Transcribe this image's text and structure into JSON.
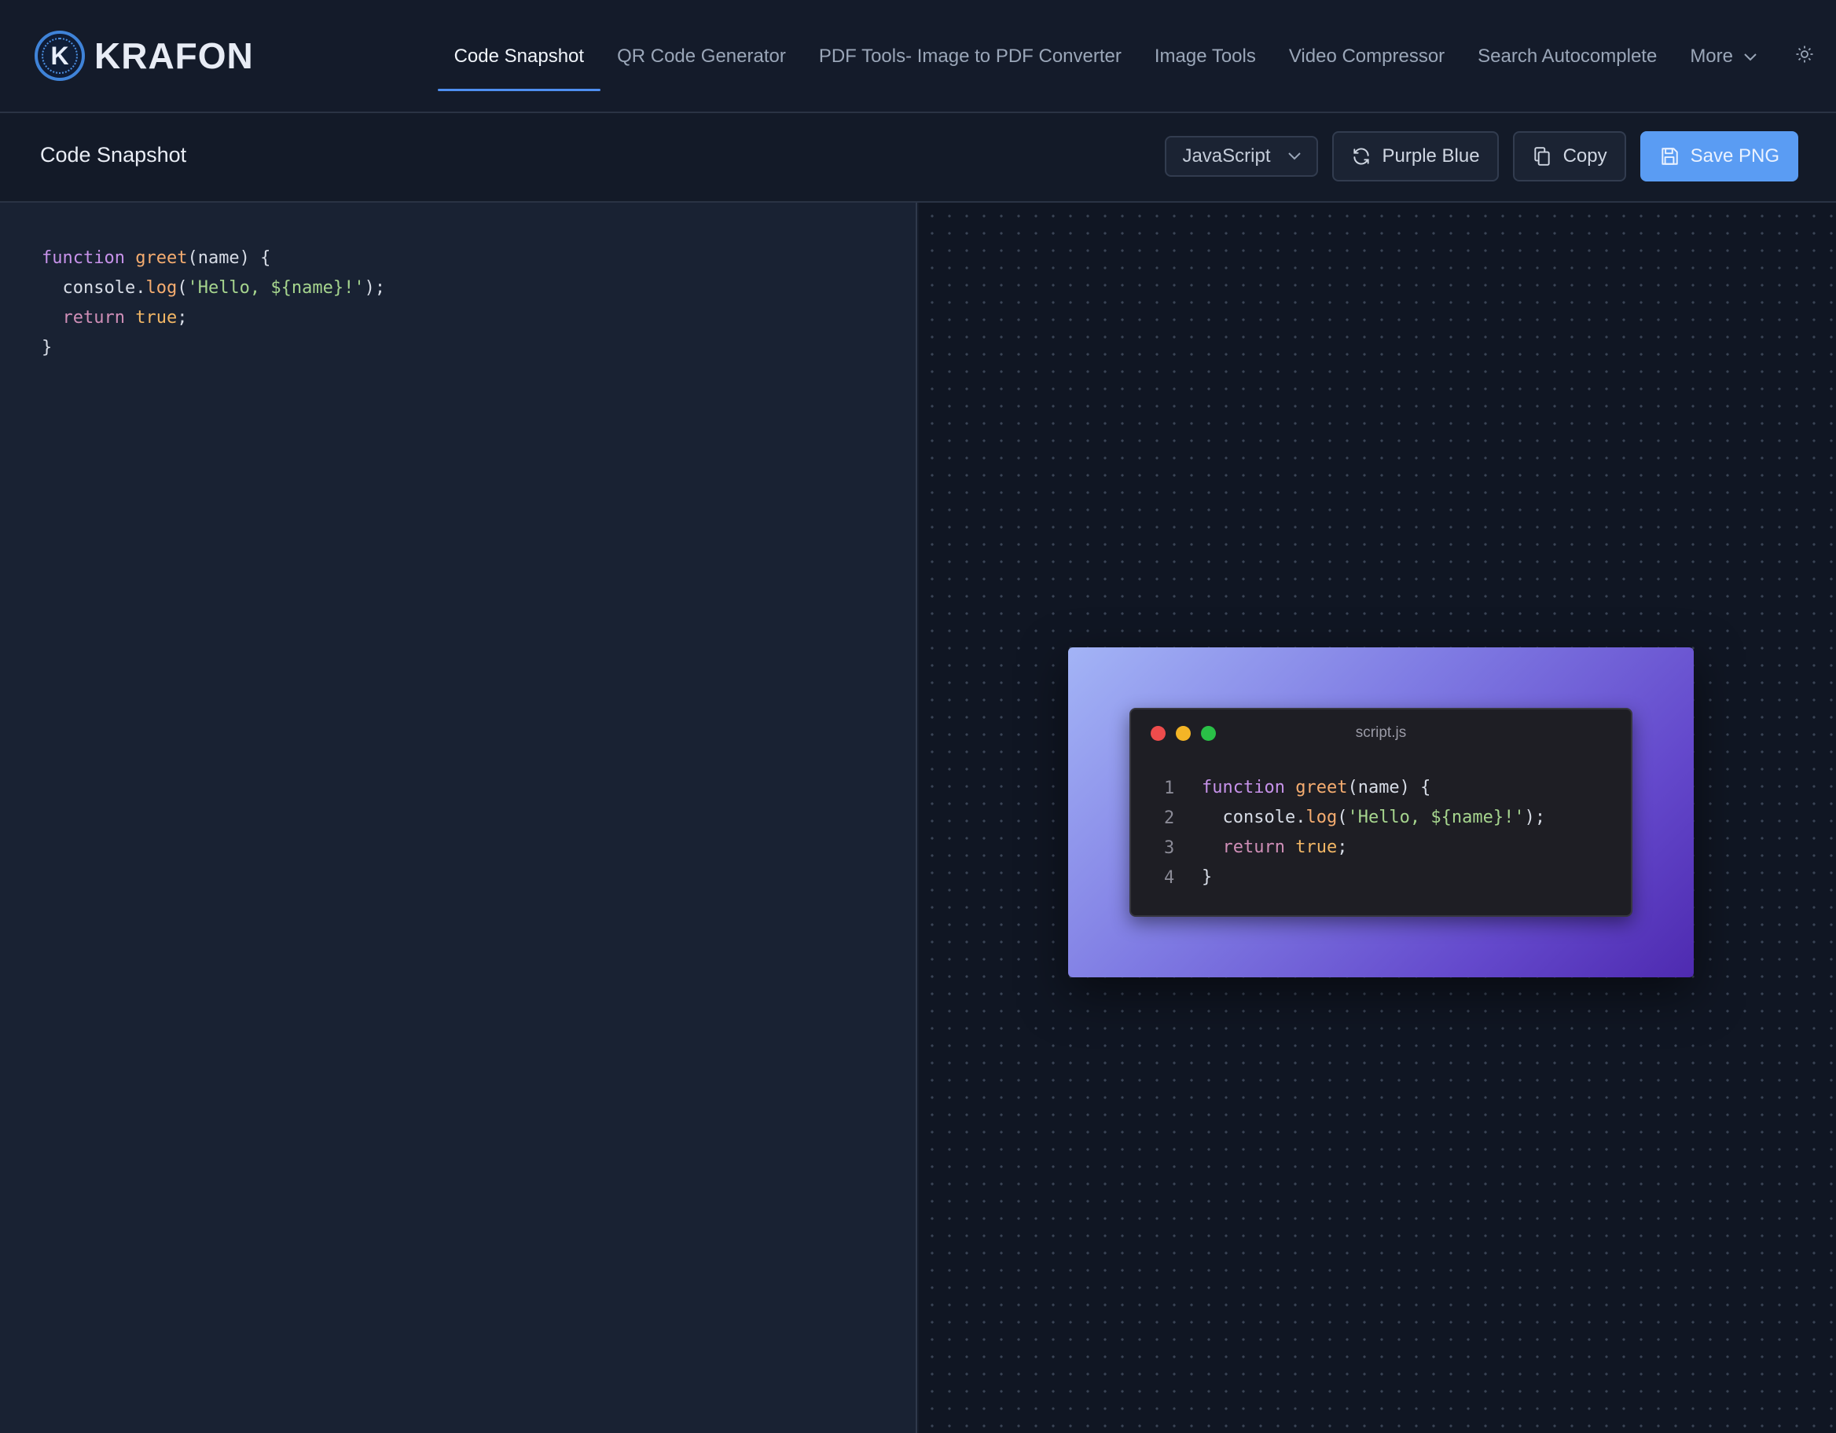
{
  "brand": {
    "logo_letter": "K",
    "name": "KRAFON"
  },
  "nav": {
    "items": [
      {
        "label": "Code Snapshot",
        "active": true
      },
      {
        "label": "QR Code Generator"
      },
      {
        "label": "PDF Tools- Image to PDF Converter"
      },
      {
        "label": "Image Tools"
      },
      {
        "label": "Video Compressor"
      },
      {
        "label": "Search Autocomplete"
      },
      {
        "label": "More"
      }
    ],
    "more_icon": "chevron-down-icon",
    "theme_icon": "sun-icon"
  },
  "toolbar": {
    "title": "Code Snapshot",
    "language": "JavaScript",
    "theme_label": "Purple Blue",
    "copy_label": "Copy",
    "save_label": "Save PNG"
  },
  "editor": {
    "lines": [
      "function greet(name) {",
      "  console.log('Hello, ${name}!');",
      "  return true;",
      "}"
    ]
  },
  "preview": {
    "filename": "script.js",
    "line_numbers": [
      "1",
      "2",
      "3",
      "4"
    ],
    "gradient_name": "Purple Blue",
    "gradient_colors": [
      "#a3b4f6",
      "#7f7be3",
      "#6449cc",
      "#4e2ab0"
    ]
  },
  "colors": {
    "accent": "#5a9cf3",
    "keyword": "#c792ea",
    "function": "#f6ad70",
    "string": "#a6d58e",
    "literal": "#f3b765"
  }
}
